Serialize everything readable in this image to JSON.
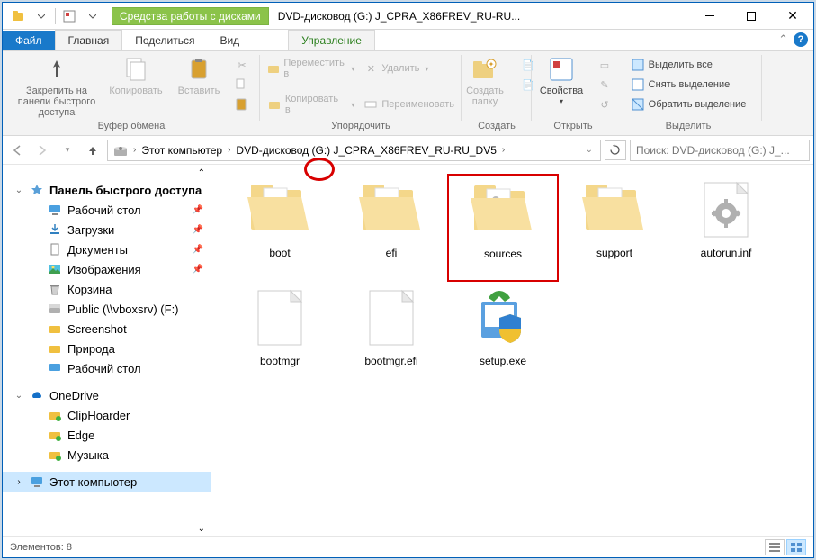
{
  "titlebar": {
    "disc_tool": "Средства работы с дисками",
    "title": "DVD-дисковод (G:) J_CPRA_X86FREV_RU-RU..."
  },
  "tabs": {
    "file": "Файл",
    "home": "Главная",
    "share": "Поделиться",
    "view": "Вид",
    "manage": "Управление"
  },
  "ribbon": {
    "pin_label": "Закрепить на панели быстрого доступа",
    "copy_label": "Копировать",
    "paste_label": "Вставить",
    "clipboard_group": "Буфер обмена",
    "move_to": "Переместить в",
    "copy_to": "Копировать в",
    "delete": "Удалить",
    "rename": "Переименовать",
    "organize_group": "Упорядочить",
    "new_folder": "Создать папку",
    "new_group": "Создать",
    "properties": "Свойства",
    "open_group": "Открыть",
    "select_all": "Выделить все",
    "select_none": "Снять выделение",
    "invert": "Обратить выделение",
    "select_group": "Выделить"
  },
  "breadcrumb": {
    "pc": "Этот компьютер",
    "drive": "DVD-дисковод (G:) J_CPRA_X86FREV_RU-RU_DV5"
  },
  "search_placeholder": "Поиск: DVD-дисковод (G:) J_...",
  "sidebar": {
    "quick": "Панель быстрого доступа",
    "desktop": "Рабочий стол",
    "downloads": "Загрузки",
    "documents": "Документы",
    "pictures": "Изображения",
    "trash": "Корзина",
    "public": "Public (\\\\vboxsrv) (F:)",
    "screenshot": "Screenshot",
    "nature": "Природа",
    "desktop2": "Рабочий стол",
    "onedrive": "OneDrive",
    "cliphoarder": "ClipHoarder",
    "edge": "Edge",
    "music": "Музыка",
    "thispc": "Этот компьютер"
  },
  "items": {
    "boot": "boot",
    "efi": "efi",
    "sources": "sources",
    "support": "support",
    "autorun": "autorun.inf",
    "bootmgr": "bootmgr",
    "bootmgr_efi": "bootmgr.efi",
    "setup": "setup.exe"
  },
  "status": {
    "count": "Элементов: 8"
  }
}
